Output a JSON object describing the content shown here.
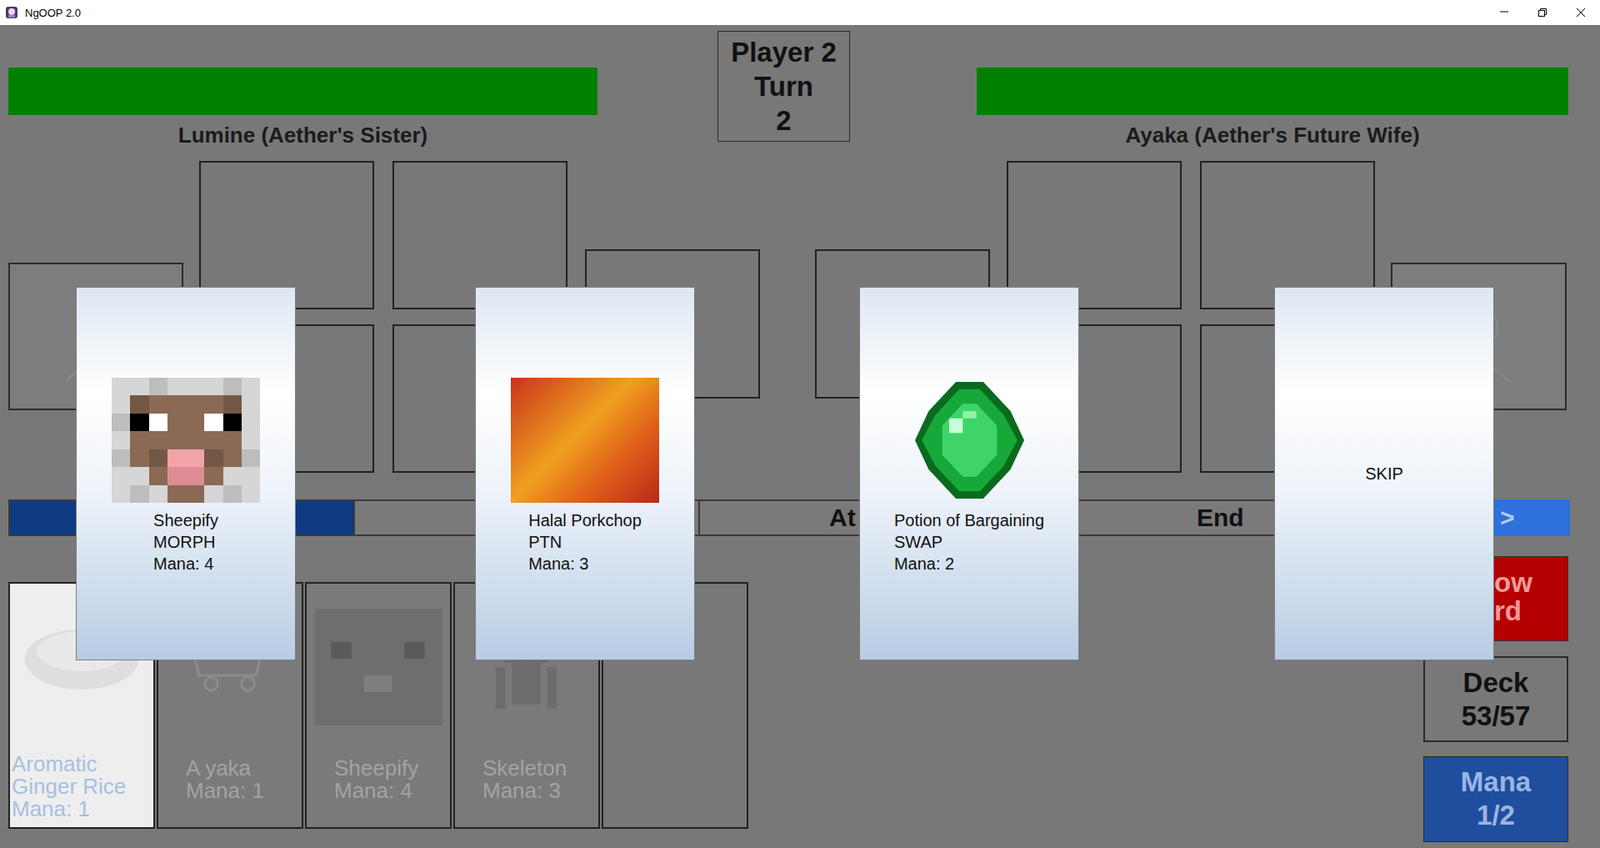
{
  "window": {
    "title": "NgOOP 2.0"
  },
  "turn": {
    "player": "Player 2",
    "label": "Turn",
    "number": "2"
  },
  "players": [
    {
      "name": "Lumine (Aether's Sister)",
      "hp": 1
    },
    {
      "name": "Ayaka (Aether's Future Wife)",
      "hp": 1
    }
  ],
  "phases": [
    {
      "selected": true
    },
    {
      "selected": false
    },
    {
      "label": "At",
      "selected": false
    },
    {
      "label": "End",
      "selected": false
    }
  ],
  "next_button": {
    "label": ">"
  },
  "hand": [
    {
      "name": "Aromatic Ginger Rice",
      "mana": "Mana: 1",
      "highlighted": true
    },
    {
      "name": "A yaka",
      "mana": "Mana: 1",
      "highlighted": false
    },
    {
      "name": "Sheepify",
      "mana": "Mana: 4",
      "highlighted": false
    },
    {
      "name": "Skeleton",
      "mana": "Mana: 3",
      "highlighted": false
    }
  ],
  "draw_button": {
    "lines": [
      "ow",
      "rd"
    ]
  },
  "deck": {
    "label": "Deck",
    "count": "53/57"
  },
  "mana": {
    "label": "Mana",
    "count": "1/2"
  },
  "choices": [
    {
      "kind": "card",
      "name": "Sheepify",
      "type": "MORPH",
      "mana": "Mana: 4"
    },
    {
      "kind": "card",
      "name": "Halal Porkchop",
      "type": "PTN",
      "mana": "Mana: 3"
    },
    {
      "kind": "card",
      "name": "Potion of Bargaining",
      "type": "SWAP",
      "mana": "Mana: 2"
    },
    {
      "kind": "skip",
      "name": "SKIP"
    }
  ]
}
